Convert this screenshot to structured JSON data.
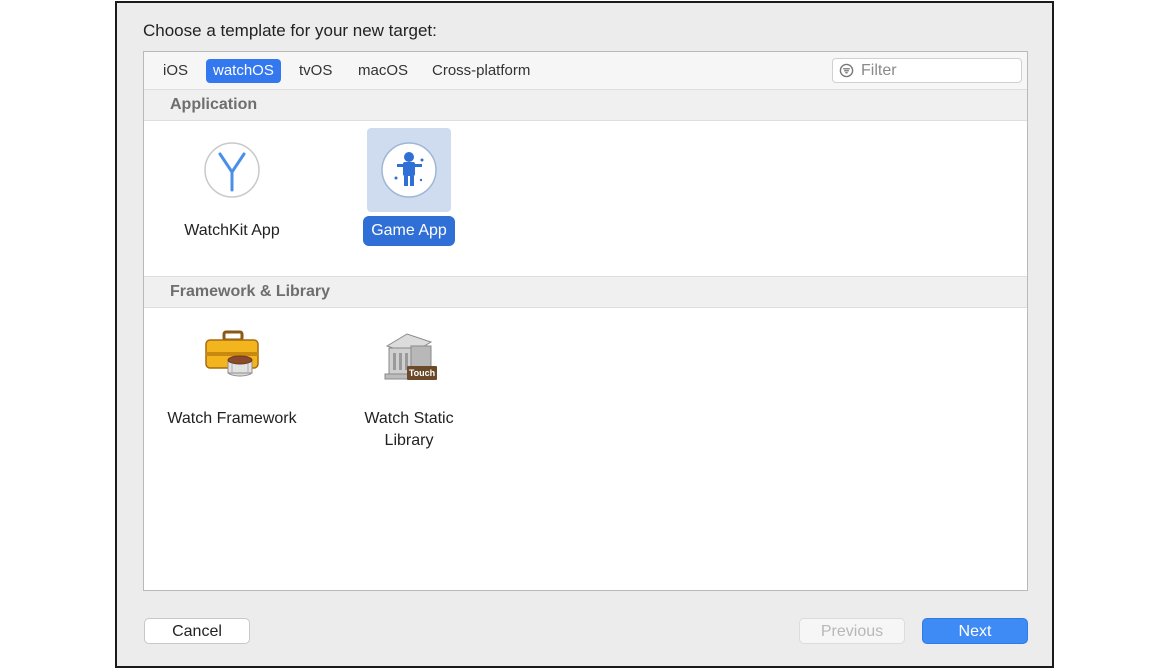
{
  "dialog": {
    "prompt": "Choose a template for your new target:"
  },
  "tabs": [
    {
      "label": "iOS",
      "selected": false
    },
    {
      "label": "watchOS",
      "selected": true
    },
    {
      "label": "tvOS",
      "selected": false
    },
    {
      "label": "macOS",
      "selected": false
    },
    {
      "label": "Cross-platform",
      "selected": false
    }
  ],
  "filter": {
    "placeholder": "Filter",
    "value": "",
    "icon": "filter-icon"
  },
  "sections": [
    {
      "title": "Application",
      "items": [
        {
          "label": "WatchKit App",
          "icon": "watchkit-app-icon",
          "selected": false
        },
        {
          "label": "Game App",
          "icon": "game-app-icon",
          "selected": true
        }
      ]
    },
    {
      "title": "Framework & Library",
      "items": [
        {
          "label": "Watch Framework",
          "icon": "watch-framework-icon",
          "selected": false
        },
        {
          "label": "Watch Static\nLibrary",
          "icon": "watch-static-library-icon",
          "selected": false,
          "badge": "Touch"
        }
      ]
    }
  ],
  "buttons": {
    "cancel": "Cancel",
    "previous": "Previous",
    "next": "Next"
  },
  "colors": {
    "accent": "#3478f0",
    "next_button": "#3e8bf5",
    "selection_background": "#cfdcf0"
  }
}
